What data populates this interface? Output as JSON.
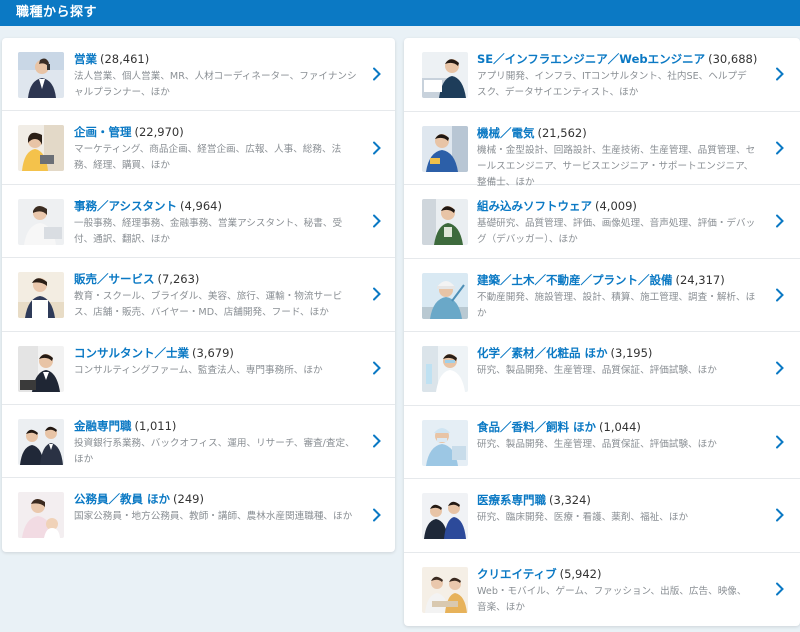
{
  "section": {
    "title": "職種から探す"
  },
  "colors": {
    "accent": "#0b79c4",
    "header_bg": "#0b79c4",
    "page_bg": "#e9f1f6"
  },
  "left": [
    {
      "title": "営業",
      "count": "(28,461)",
      "desc": "法人営業、個人営業、MR、人材コーディネーター、ファイナンシャルプランナー、ほか",
      "icon": "sales-person-photo"
    },
    {
      "title": "企画・管理",
      "count": "(22,970)",
      "desc": "マーケティング、商品企画、経営企画、広報、人事、総務、法務、経理、購買、ほか",
      "icon": "planning-person-photo"
    },
    {
      "title": "事務／アシスタント",
      "count": "(4,964)",
      "desc": "一般事務、経理事務、金融事務、営業アシスタント、秘書、受付、通訳、翻訳、ほか",
      "icon": "office-assistant-photo"
    },
    {
      "title": "販売／サービス",
      "count": "(7,263)",
      "desc": "教育・スクール、ブライダル、美容、旅行、運輸・物流サービス、店舗・販売、バイヤー・MD、店舗開発、フード、ほか",
      "icon": "retail-service-photo"
    },
    {
      "title": "コンサルタント／士業",
      "count": "(3,679)",
      "desc": "コンサルティングファーム、監査法人、専門事務所、ほか",
      "icon": "consultant-photo"
    },
    {
      "title": "金融専門職",
      "count": "(1,011)",
      "desc": "投資銀行系業務、バックオフィス、運用、リサーチ、審査/査定、ほか",
      "icon": "finance-professional-photo"
    },
    {
      "title": "公務員／教員 ほか",
      "count": "(249)",
      "desc": "国家公務員・地方公務員、教師・講師、農林水産関連職種、ほか",
      "icon": "public-servant-photo"
    }
  ],
  "right": [
    {
      "title": "SE／インフラエンジニア／Webエンジニア",
      "count": "(30,688)",
      "desc": "アプリ開発、インフラ、ITコンサルタント、社内SE、ヘルプデスク、データサイエンティスト、ほか",
      "icon": "it-engineer-photo"
    },
    {
      "title": "機械／電気",
      "count": "(21,562)",
      "desc": "機械・金型設計、回路設計、生産技術、生産管理、品質管理、セールスエンジニア、サービスエンジニア・サポートエンジニア、整備士、ほか",
      "icon": "mechanical-engineer-photo"
    },
    {
      "title": "組み込みソフトウェア",
      "count": "(4,009)",
      "desc": "基礎研究、品質管理、評価、画像処理、音声処理、評価・デバッグ（デバッガー）、ほか",
      "icon": "embedded-software-photo"
    },
    {
      "title": "建築／土木／不動産／プラント／設備",
      "count": "(24,317)",
      "desc": "不動産開発、施設管理、設計、積算、施工管理、調査・解析、ほか",
      "icon": "construction-photo"
    },
    {
      "title": "化学／素材／化粧品 ほか",
      "count": "(3,195)",
      "desc": "研究、製品開発、生産管理、品質保証、評価試験、ほか",
      "icon": "chemistry-photo"
    },
    {
      "title": "食品／香料／飼料 ほか",
      "count": "(1,044)",
      "desc": "研究、製品開発、生産管理、品質保証、評価試験、ほか",
      "icon": "food-photo"
    },
    {
      "title": "医療系専門職",
      "count": "(3,324)",
      "desc": "研究、臨床開発、医療・看護、薬剤、福祉、ほか",
      "icon": "medical-photo"
    },
    {
      "title": "クリエイティブ",
      "count": "(5,942)",
      "desc": "Web・モバイル、ゲーム、ファッション、出版、広告、映像、音楽、ほか",
      "icon": "creative-photo"
    }
  ]
}
